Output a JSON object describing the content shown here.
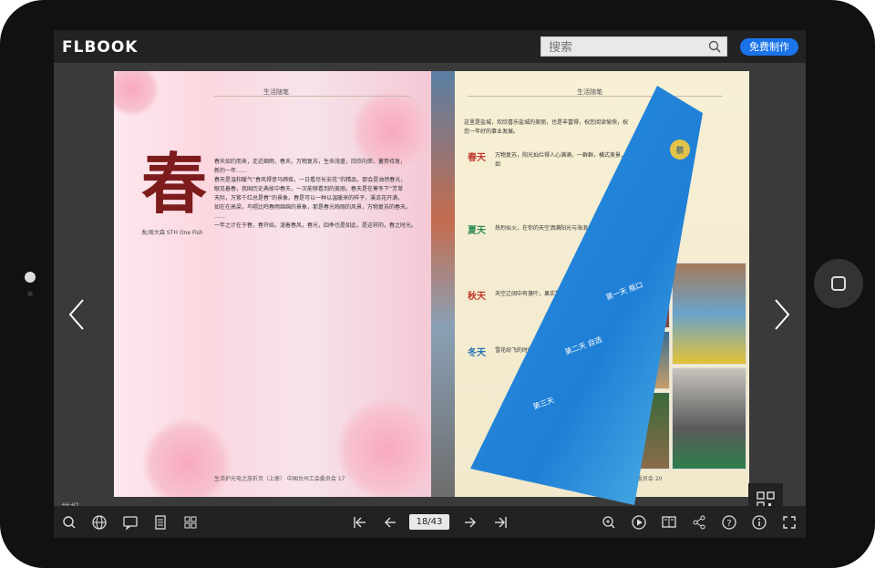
{
  "app": {
    "logo_text": "FLBOOK",
    "search_placeholder": "搜索",
    "make_button": "免费制作",
    "report_label": "举报",
    "page_indicator": "18/43"
  },
  "book": {
    "left_page": {
      "header": "生活随笔",
      "big_char": "春",
      "author": "发/周大森 STH One Fish",
      "body_lines": [
        "春天如约而来，走近细雨，春天，万物复苏，生命茂盛，欣欣向荣，蓄势待发，",
        "新的一年……",
        "春天是温和暖气“春风得意马蹄疾，一日看尽长安花”的精品，那会是油然春光，",
        "眼见着春，我国历史典故中春天，一次能够看到的美丽。春天是在寒冬下“芳草",
        "天际，万紫千红总是春”的景象。春是可以一种以温暖来的样子，溪流花开满，",
        "如在在高梁，鸟唱比鸣春雨绵绵的景象，那是春光绚丽的风景，万物复苏的春天。",
        "……",
        "一年之计在于春，春开始，溜着春风，春光，四季也是如此，是这样的，春之时光。"
      ],
      "footer": "生活护光电之旅折页（上册）  中国台州工会委员会  17"
    },
    "right_page": {
      "header": "生活随笔",
      "intro_lines": [
        "这里是盐城，欢欣喜乐盐城的美丽，也是丰富得，祝您阅读愉快，祝",
        "您一年好的事业发展。"
      ],
      "seasons": [
        {
          "name": "春天",
          "text": "万物复苏，阳光灿烂得人心满满，一群群，横式美景，美丽如"
        },
        {
          "name": "夏天",
          "text": "热烈似火，在你的天空洒满阳光与海浪，绿意盎然"
        },
        {
          "name": "秋天",
          "text": "天空辽阔中有落叶，果实累累充满人心"
        },
        {
          "name": "冬天",
          "text": "雪花纷飞的时候，蕴藏着新的开始"
        }
      ],
      "footer": "生活护光电之旅折页（上册）  中国台州工会委员会  20"
    },
    "curl_texts": [
      "蔡",
      "第一天 瓶口",
      "第二天 自选",
      "第三天"
    ]
  },
  "colors": {
    "accent": "#1a73e8",
    "curl_blue": "#1f7fd6",
    "season_red": "#c0392b",
    "big_char": "#7d1c1c"
  },
  "icons": {
    "search": "search-icon",
    "prev": "chevron-left-icon",
    "next": "chevron-right-icon",
    "qr": "qr-code-icon"
  }
}
